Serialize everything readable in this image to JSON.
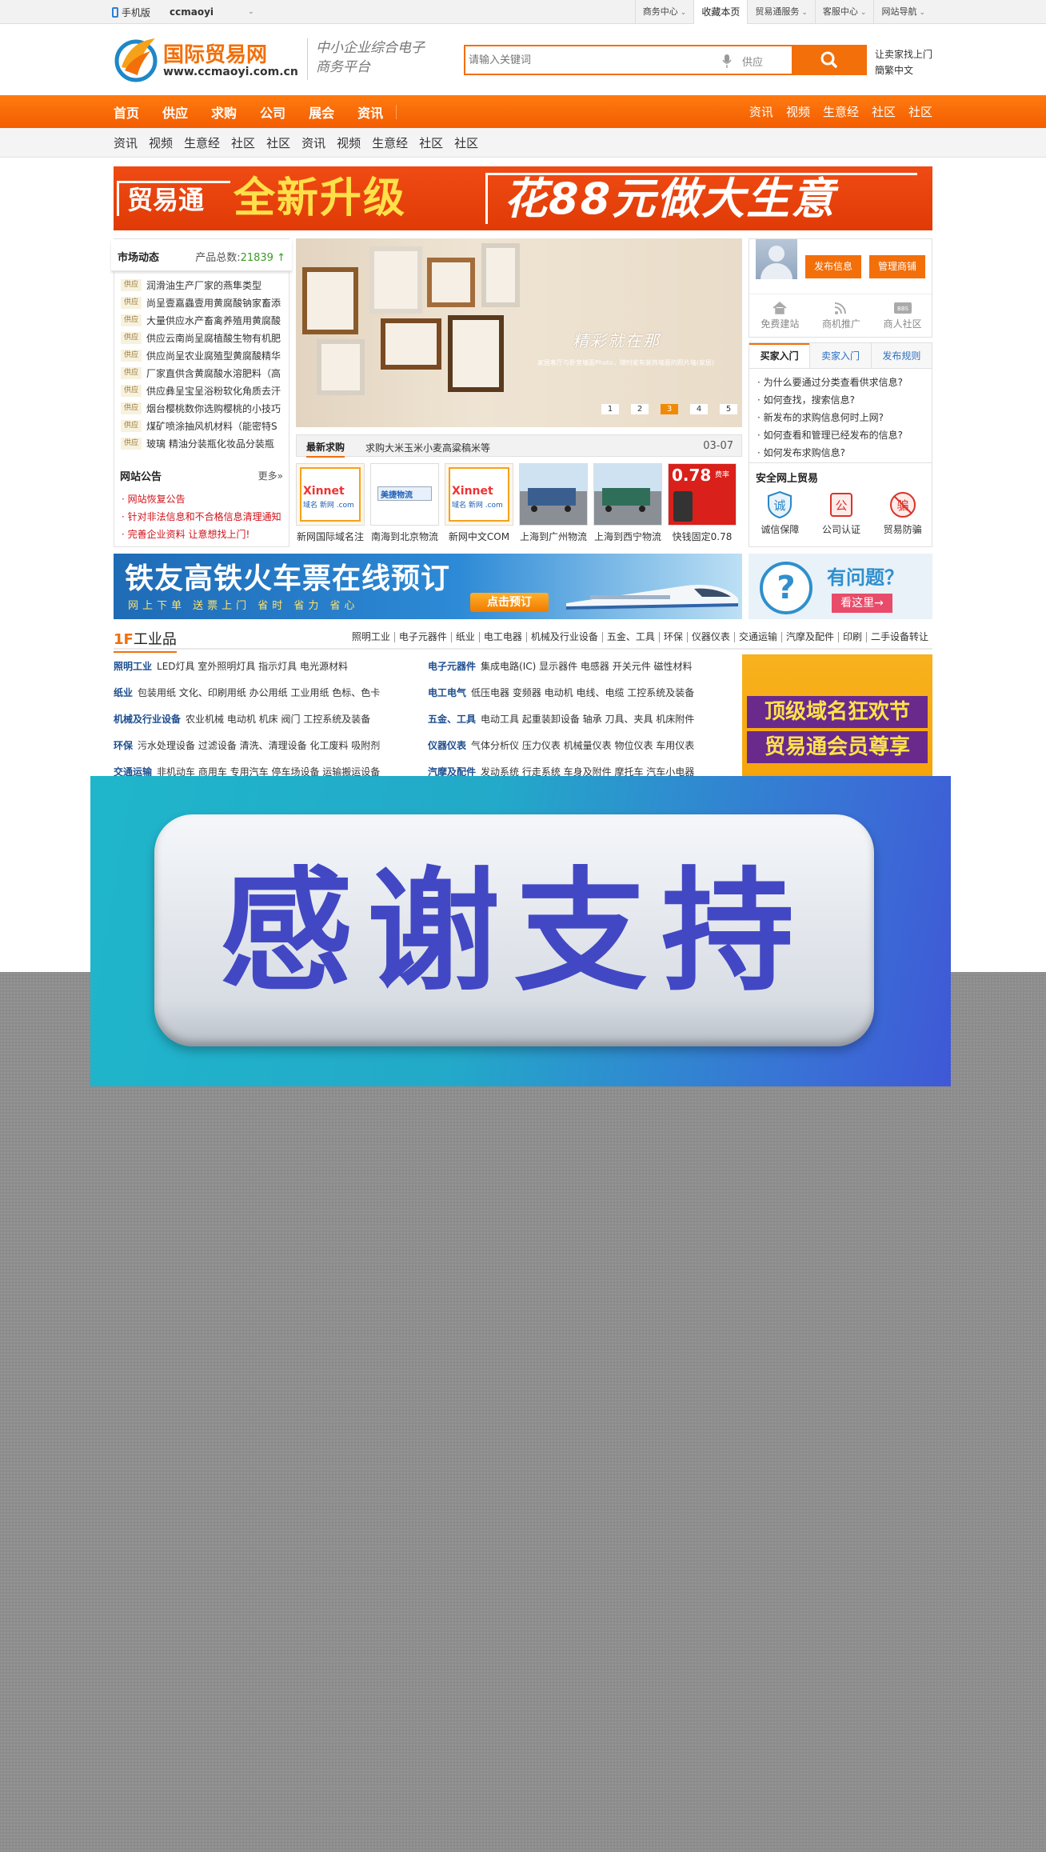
{
  "topbar": {
    "mobile_label": "手机版",
    "site_user": "ccmaoyi",
    "links": [
      "商务中心",
      "收藏本页",
      "贸易通服务",
      "客服中心",
      "网站导航"
    ]
  },
  "header": {
    "logo_cn": "国际贸易网",
    "logo_url": "www.ccmaoyi.com.cn",
    "slogan_line1": "中小企业综合电子",
    "slogan_line2": "商务平台",
    "search_placeholder": "请输入关键词",
    "search_category": "供应",
    "right_line1": "让卖家找上门",
    "right_line2": "簡繁中文"
  },
  "mainnav": {
    "left": [
      "首页",
      "供应",
      "求购",
      "公司",
      "展会",
      "资讯"
    ],
    "right": [
      "资讯",
      "视频",
      "生意经",
      "社区",
      "社区"
    ]
  },
  "subnav": [
    "资讯",
    "视频",
    "生意经",
    "社区",
    "社区",
    "资讯",
    "视频",
    "生意经",
    "社区",
    "社区"
  ],
  "banner": {
    "part1": "贸易通",
    "part2": "全新升级",
    "part3": "花88元做大生意"
  },
  "market": {
    "title": "市场动态",
    "count_label": "产品总数:",
    "count": "21839",
    "tag": "供应",
    "items": [
      "润滑油生产厂家的燕隼类型",
      "尚呈壹嘉蟲壹用黄腐酸钠家畜添",
      "大量供应水产畜禽养殖用黄腐酸",
      "供应云南尚呈腐植酸生物有机肥",
      "供应尚呈农业腐殖型黄腐酸精华",
      "厂家直供含黄腐酸水溶肥料（高",
      "供应彝呈宝呈浴粉软化角质去汗",
      "烟台樱桃数你选购樱桃的小技巧",
      "煤矿喷涂抽风机材料（能密特S",
      "玻璃 精油分装瓶化妆品分装瓶"
    ]
  },
  "notice": {
    "title": "网站公告",
    "more": "更多»",
    "items": [
      "网站恢复公告",
      "针对非法信息和不合格信息清理通知",
      "完善企业资料 让意想找上门!"
    ]
  },
  "slider": {
    "caption": "精彩就在那",
    "sub": "家居客厅与卧室墙面Photo，随时能有装饰墙面的照片墙(家居)",
    "dots": [
      "1",
      "2",
      "3",
      "4",
      "5"
    ],
    "active": 2
  },
  "latest": {
    "title": "最新求购",
    "text": "求购大米玉米小麦高粱稿米等",
    "date": "03-07"
  },
  "thumbs": [
    {
      "label": "新网国际域名注",
      "kind": "xinnet"
    },
    {
      "label": "南海到北京物流",
      "kind": "logistics"
    },
    {
      "label": "新网中文COM",
      "kind": "xinnet"
    },
    {
      "label": "上海到广州物流",
      "kind": "truck"
    },
    {
      "label": "上海到西宁物流",
      "kind": "truck"
    },
    {
      "label": "快钱固定0.78",
      "kind": "pos"
    }
  ],
  "thumb_text": {
    "xinnet": "Xinnet",
    "xinnet_com": "域名 新网 .com",
    "logistics": "美捷物流",
    "pos_rate": "0.78",
    "pos_unit": "费率"
  },
  "userbox": {
    "btn_publish": "发布信息",
    "btn_manage": "管理商铺",
    "icons": [
      {
        "name": "home-icon",
        "label": "免费建站"
      },
      {
        "name": "rss-icon",
        "label": "商机推广"
      },
      {
        "name": "bbs-icon",
        "label": "商人社区"
      }
    ]
  },
  "tabs": {
    "items": [
      "买家入门",
      "卖家入门",
      "发布规则"
    ],
    "faq": [
      "为什么要通过分类查看供求信息?",
      "如何查找，搜索信息?",
      "新发布的求购信息何时上网?",
      "如何查看和管理已经发布的信息?",
      "如何发布求购信息?"
    ]
  },
  "safe": {
    "title": "安全网上贸易",
    "items": [
      {
        "glyph": "诚",
        "label": "诚信保障",
        "color": "#2d86c4"
      },
      {
        "glyph": "公",
        "label": "公司认证",
        "color": "#d9342b"
      },
      {
        "glyph": "骗",
        "label": "贸易防骗",
        "color": "#d9342b"
      }
    ]
  },
  "train": {
    "title": "铁友高铁火车票在线预订",
    "sub": "网上下单  送票上门  省时  省力  省心",
    "button": "点击预订"
  },
  "help": {
    "q": "?",
    "title": "有问题？",
    "button": "看这里→"
  },
  "floor": {
    "num": "1F",
    "title": "工业品",
    "links": [
      "照明工业",
      "电子元器件",
      "纸业",
      "电工电器",
      "机械及行业设备",
      "五金、工具",
      "环保",
      "仪器仪表",
      "交通运输",
      "汽摩及配件",
      "印刷",
      "二手设备转让"
    ],
    "rows_left": [
      {
        "cat": "照明工业",
        "items": "LED灯具  室外照明灯具  指示灯具  电光源材料"
      },
      {
        "cat": "纸业",
        "items": "包装用纸  文化、印刷用纸  办公用纸  工业用纸  色标、色卡"
      },
      {
        "cat": "机械及行业设备",
        "items": "农业机械  电动机  机床  阀门  工控系统及装备"
      },
      {
        "cat": "环保",
        "items": "污水处理设备  过滤设备  清洗、清理设备  化工废料  吸附剂"
      },
      {
        "cat": "交通运输",
        "items": "非机动车  商用车  专用汽车  停车场设备  运输搬运设备"
      }
    ],
    "rows_right": [
      {
        "cat": "电子元器件",
        "items": "集成电路(IC)  显示器件  电感器  开关元件  磁性材料"
      },
      {
        "cat": "电工电气",
        "items": "低压电器  变频器  电动机  电线、电缆  工控系统及装备"
      },
      {
        "cat": "五金、工具",
        "items": "电动工具  起重装卸设备  轴承  刀具、夹具  机床附件"
      },
      {
        "cat": "仪器仪表",
        "items": "气体分析仪  压力仪表  机械量仪表  物位仪表  车用仪表"
      },
      {
        "cat": "汽摩及配件",
        "items": "发动系统  行走系统  车身及附件  摩托车  汽车小电器"
      }
    ]
  },
  "promo": {
    "line1": "顶级域名狂欢节",
    "line2": "贸易通会员尊享"
  },
  "overlay": {
    "text": "感谢支持"
  },
  "colors": {
    "accent": "#f26f0a",
    "link_blue": "#1d4e8f",
    "notice_red": "#d0121a"
  }
}
